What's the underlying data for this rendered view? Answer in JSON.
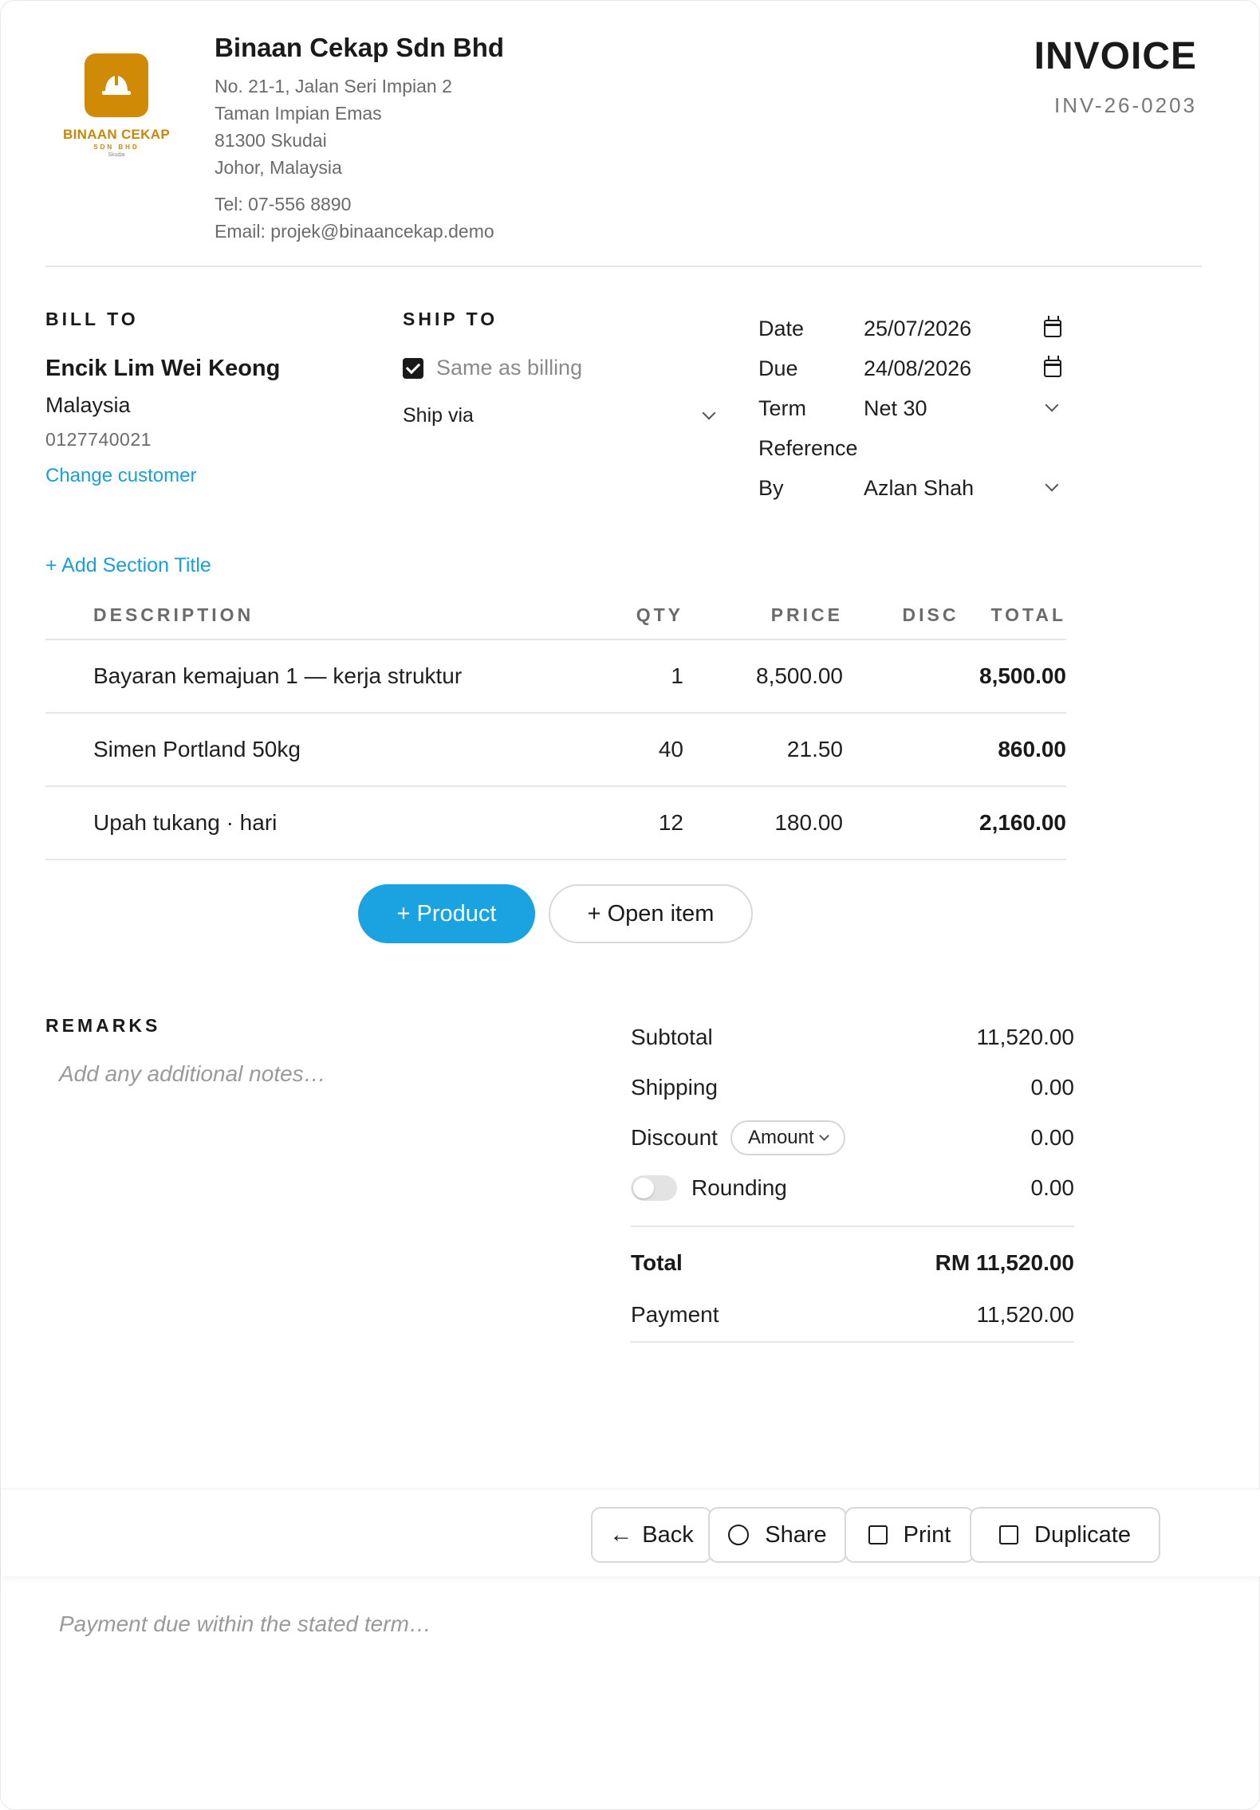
{
  "company": {
    "logo_name": "BINAAN CEKAP",
    "logo_sub": "SDN BHD",
    "logo_loc": "Skudai",
    "name": "Binaan Cekap Sdn Bhd",
    "address": [
      "No. 21-1, Jalan Seri Impian 2",
      "Taman Impian Emas",
      "81300 Skudai",
      "Johor, Malaysia"
    ],
    "tel": "Tel: 07-556 8890",
    "email": "Email: projek@binaancekap.demo"
  },
  "invoice": {
    "title": "INVOICE",
    "number": "INV-26-0203"
  },
  "bill_to": {
    "label": "BILL TO",
    "name": "Encik Lim Wei Keong",
    "country": "Malaysia",
    "phone": "0127740021",
    "change_link": "Change customer"
  },
  "ship_to": {
    "label": "SHIP TO",
    "same_as_billing": "Same as billing",
    "same_checked": true,
    "ship_via": "Ship via"
  },
  "meta": {
    "date_label": "Date",
    "date_value": "25/07/2026",
    "due_label": "Due",
    "due_value": "24/08/2026",
    "term_label": "Term",
    "term_value": "Net 30",
    "reference_label": "Reference",
    "reference_value": "",
    "by_label": "By",
    "by_value": "Azlan Shah"
  },
  "items": {
    "add_section": "+ Add Section Title",
    "headers": {
      "description": "DESCRIPTION",
      "qty": "QTY",
      "price": "PRICE",
      "disc": "DISC",
      "total": "TOTAL"
    },
    "rows": [
      {
        "description": "Bayaran kemajuan 1 — kerja struktur",
        "qty": "1",
        "price": "8,500.00",
        "disc": "",
        "total": "8,500.00"
      },
      {
        "description": "Simen Portland 50kg",
        "qty": "40",
        "price": "21.50",
        "disc": "",
        "total": "860.00"
      },
      {
        "description": "Upah tukang · hari",
        "qty": "12",
        "price": "180.00",
        "disc": "",
        "total": "2,160.00"
      }
    ],
    "add_product": "+ Product",
    "add_open_item": "+ Open item"
  },
  "remarks": {
    "label": "REMARKS",
    "placeholder": "Add any additional notes…"
  },
  "totals": {
    "subtotal_label": "Subtotal",
    "subtotal_value": "11,520.00",
    "shipping_label": "Shipping",
    "shipping_value": "0.00",
    "discount_label": "Discount",
    "discount_type": "Amount",
    "discount_value": "0.00",
    "rounding_label": "Rounding",
    "rounding_on": false,
    "rounding_value": "0.00",
    "total_label": "Total",
    "total_value": "RM 11,520.00",
    "payment_label": "Payment",
    "payment_value": "11,520.00"
  },
  "actions": {
    "back": "Back",
    "share": "Share",
    "print": "Print",
    "duplicate": "Duplicate"
  },
  "footer": {
    "placeholder": "Payment due within the stated term…"
  },
  "colors": {
    "accent": "#1aa3e0",
    "link": "#1a9fdb",
    "brand": "#d08a06"
  }
}
